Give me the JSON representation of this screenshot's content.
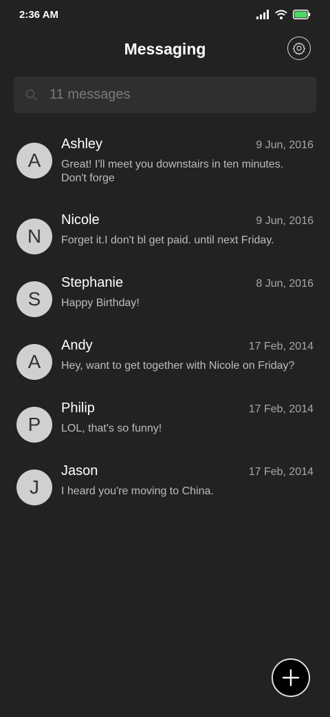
{
  "status_bar": {
    "time": "2:36 AM",
    "battery_color": "#4cd964"
  },
  "header": {
    "title": "Messaging"
  },
  "search": {
    "placeholder": "11 messages"
  },
  "icons": {
    "settings": "settings-icon",
    "search": "search-icon",
    "add": "plus-icon"
  },
  "conversations": [
    {
      "initial": "A",
      "name": "Ashley",
      "date": "9 Jun, 2016",
      "preview": "Great! I'll meet you downstairs in ten minutes. Don't forge"
    },
    {
      "initial": "N",
      "name": "Nicole",
      "date": "9 Jun, 2016",
      "preview": "Forget it.I don't bl get paid. until next Friday."
    },
    {
      "initial": "S",
      "name": "Stephanie",
      "date": "8 Jun, 2016",
      "preview": "Happy Birthday!"
    },
    {
      "initial": "A",
      "name": "Andy",
      "date": "17 Feb, 2014",
      "preview": "Hey, want to get together with Nicole on Friday?"
    },
    {
      "initial": "P",
      "name": "Philip",
      "date": "17 Feb, 2014",
      "preview": "LOL, that's so funny!"
    },
    {
      "initial": "J",
      "name": "Jason",
      "date": "17 Feb, 2014",
      "preview": "I heard you're moving to China."
    }
  ]
}
